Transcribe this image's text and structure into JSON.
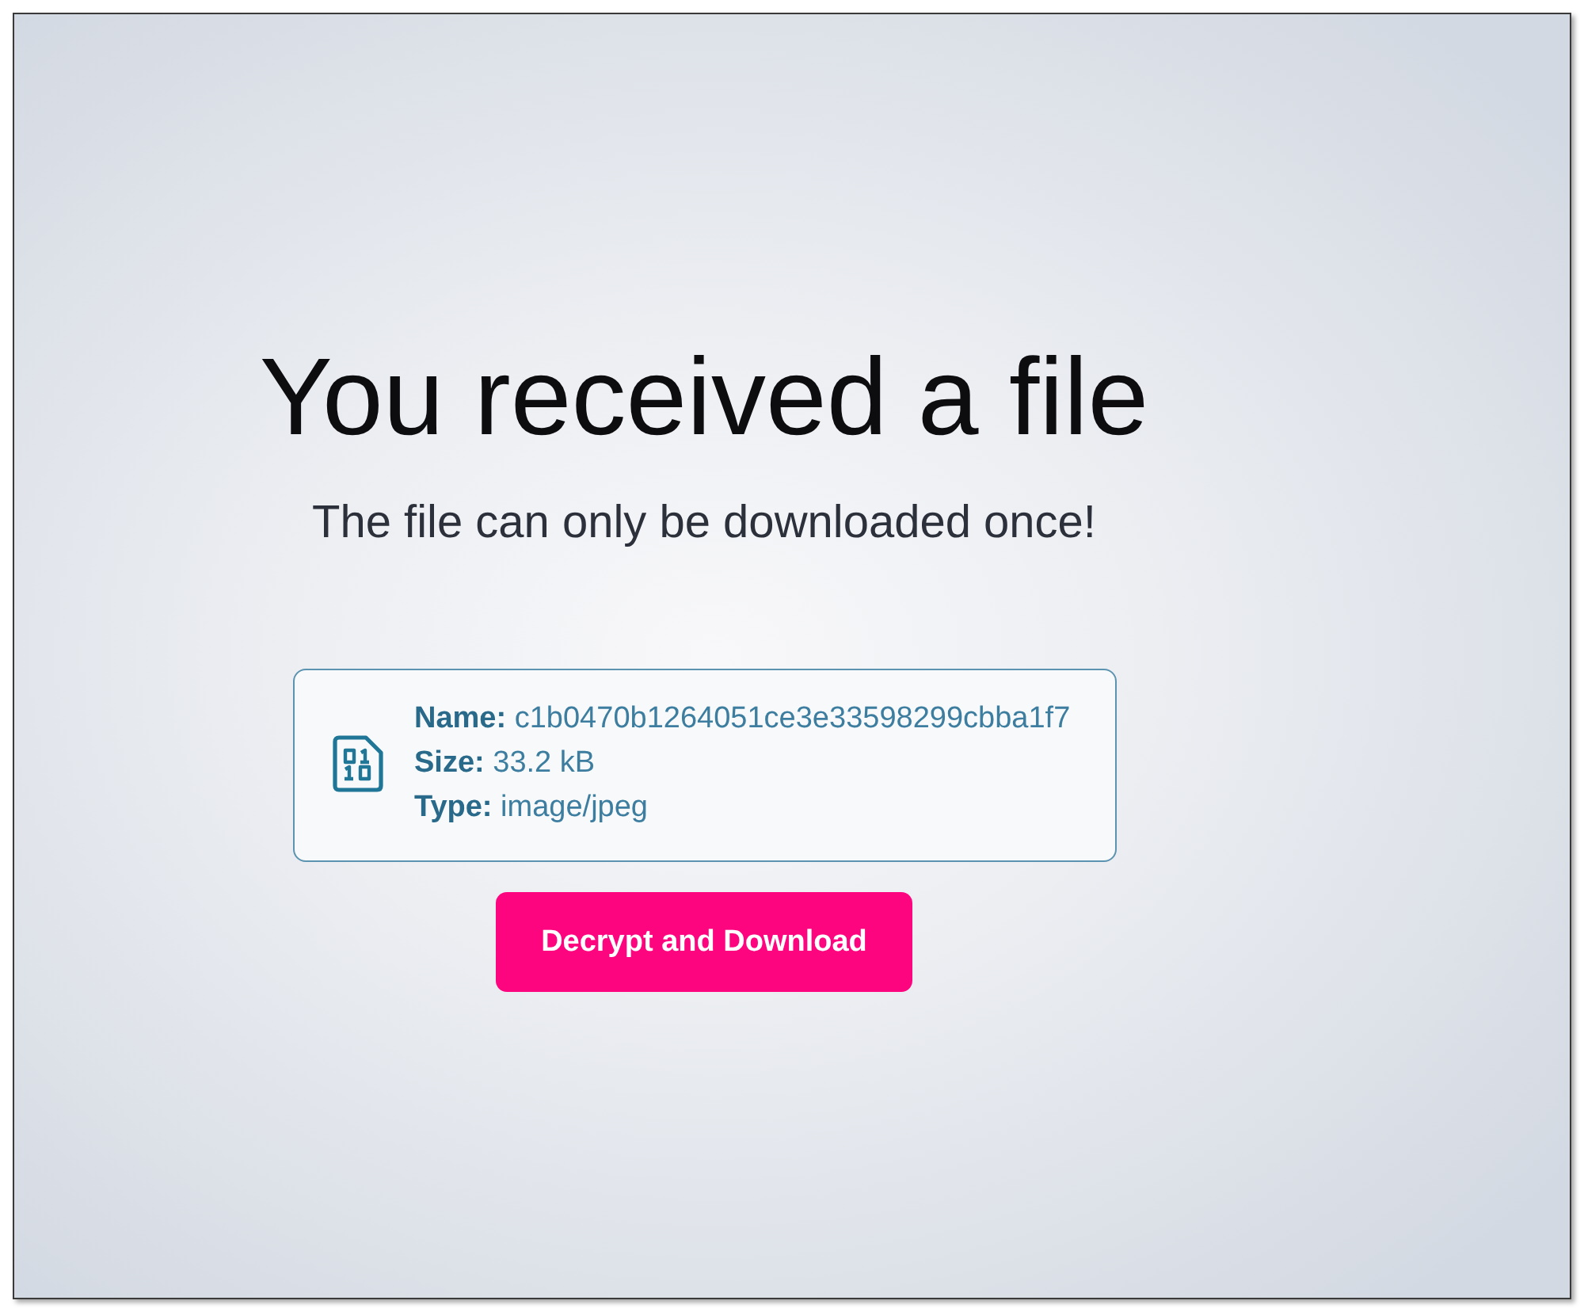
{
  "heading": "You received a file",
  "subheading": "The file can only be downloaded once!",
  "file_info": {
    "fields": [
      {
        "label": "Name:",
        "value": "c1b0470b1264051ce3e33598299cbba1f7"
      },
      {
        "label": "Size:",
        "value": "33.2 kB"
      },
      {
        "label": "Type:",
        "value": "image/jpeg"
      }
    ]
  },
  "button": {
    "label": "Decrypt and Download"
  }
}
